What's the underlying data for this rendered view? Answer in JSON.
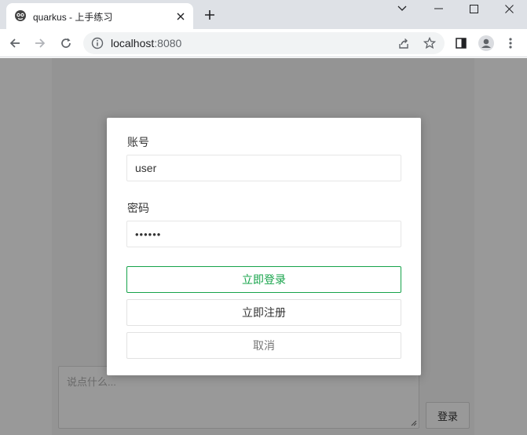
{
  "browser": {
    "tab_title": "quarkus - 上手练习",
    "url_host": "localhost",
    "url_port": ":8080",
    "favicon": "quarkus-logo-icon"
  },
  "page": {
    "comment_placeholder": "说点什么...",
    "send_label": "登录"
  },
  "login_modal": {
    "account_label": "账号",
    "account_value": "user",
    "password_label": "密码",
    "password_value": "••••••",
    "login_button": "立即登录",
    "register_button": "立即注册",
    "cancel_button": "取消"
  },
  "colors": {
    "accent": "#16a34a",
    "tab_strip": "#dee1e6",
    "omnibox": "#f1f3f4"
  }
}
